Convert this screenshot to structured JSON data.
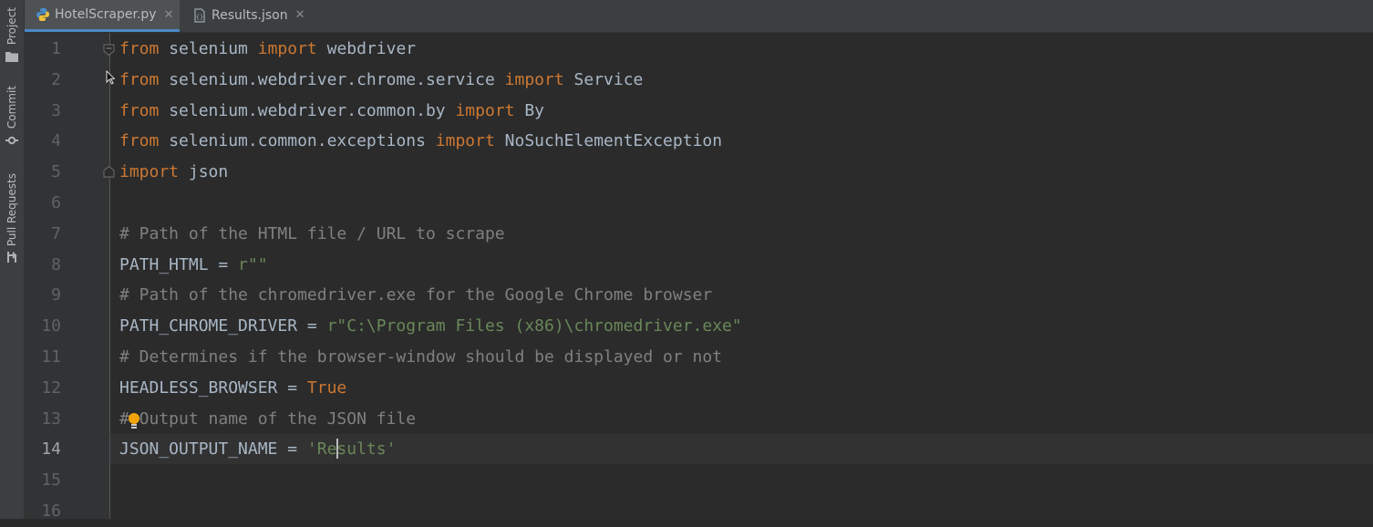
{
  "sidebar": {
    "items": [
      {
        "label": "Project",
        "icon": "folder-icon"
      },
      {
        "label": "Commit",
        "icon": "commit-icon"
      },
      {
        "label": "Pull Requests",
        "icon": "pull-request-icon"
      }
    ]
  },
  "tabs": [
    {
      "label": "HotelScraper.py",
      "icon": "python-file-icon",
      "active": true
    },
    {
      "label": "Results.json",
      "icon": "json-file-icon",
      "active": false
    }
  ],
  "editor": {
    "current_line": 14,
    "line_numbers": [
      "1",
      "2",
      "3",
      "4",
      "5",
      "6",
      "7",
      "8",
      "9",
      "10",
      "11",
      "12",
      "13",
      "14",
      "15",
      "16"
    ],
    "lines": [
      [
        {
          "t": "from",
          "c": "kw"
        },
        {
          "t": " selenium ",
          "c": "plain"
        },
        {
          "t": "import",
          "c": "kw"
        },
        {
          "t": " webdriver",
          "c": "plain"
        }
      ],
      [
        {
          "t": "from",
          "c": "kw"
        },
        {
          "t": " selenium.webdriver.chrome.service ",
          "c": "plain"
        },
        {
          "t": "import",
          "c": "kw"
        },
        {
          "t": " Service",
          "c": "plain"
        }
      ],
      [
        {
          "t": "from",
          "c": "kw"
        },
        {
          "t": " selenium.webdriver.common.by ",
          "c": "plain"
        },
        {
          "t": "import",
          "c": "kw"
        },
        {
          "t": " By",
          "c": "plain"
        }
      ],
      [
        {
          "t": "from",
          "c": "kw"
        },
        {
          "t": " selenium.common.exceptions ",
          "c": "plain"
        },
        {
          "t": "import",
          "c": "kw"
        },
        {
          "t": " NoSuchElementException",
          "c": "plain"
        }
      ],
      [
        {
          "t": "import",
          "c": "kw"
        },
        {
          "t": " json",
          "c": "plain"
        }
      ],
      [],
      [
        {
          "t": "# Path of the HTML file / URL to scrape",
          "c": "cmt"
        }
      ],
      [
        {
          "t": "PATH_HTML = ",
          "c": "plain"
        },
        {
          "t": "r\"\"",
          "c": "str"
        }
      ],
      [
        {
          "t": "# Path of the chromedriver.exe for the Google Chrome browser",
          "c": "cmt"
        }
      ],
      [
        {
          "t": "PATH_CHROME_DRIVER = ",
          "c": "plain"
        },
        {
          "t": "r\"C:\\Program Files (x86)\\chromedriver.exe\"",
          "c": "str"
        }
      ],
      [
        {
          "t": "# Determines if the browser-window should be displayed or not",
          "c": "cmt"
        }
      ],
      [
        {
          "t": "HEADLESS_BROWSER = ",
          "c": "plain"
        },
        {
          "t": "True",
          "c": "kw"
        }
      ],
      [
        {
          "t": "# Output name of the JSON file",
          "c": "cmt"
        }
      ],
      [
        {
          "t": "JSON_OUTPUT_NAME = ",
          "c": "plain"
        },
        {
          "t": "'Results'",
          "c": "str"
        }
      ],
      [],
      []
    ]
  },
  "colors": {
    "keyword": "#cc7832",
    "string": "#6a8759",
    "comment": "#808080",
    "identifier": "#a9b7c6",
    "background": "#2b2b2b",
    "active_tab_underline": "#4a88c7"
  }
}
